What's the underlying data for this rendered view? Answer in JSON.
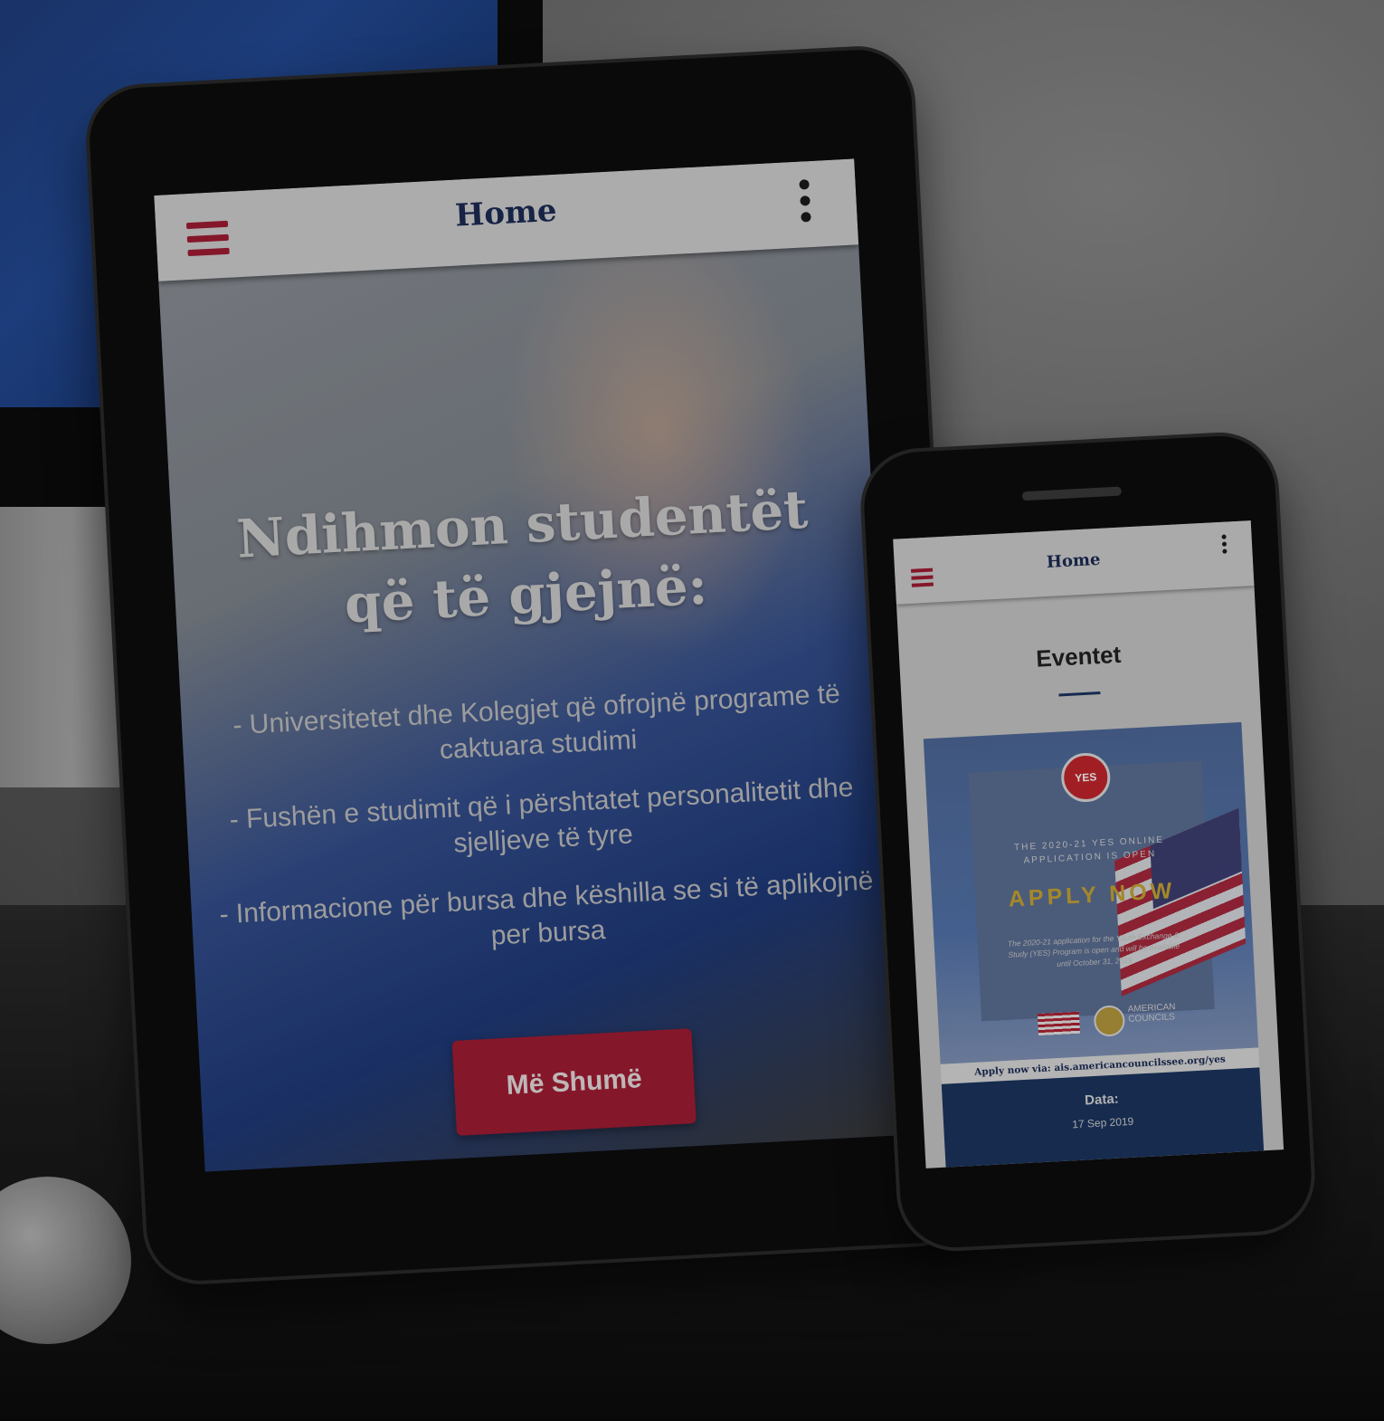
{
  "tablet": {
    "header": {
      "title": "Home",
      "menu_icon": "hamburger-icon",
      "more_icon": "more-vertical-icon"
    },
    "hero": {
      "headline": "Ndihmon studentët që të gjejnë:",
      "bullets": [
        "- Universitetet dhe Kolegjet që ofrojnë programe të caktuara studimi",
        "- Fushën e studimit që i përshtatet personalitetit dhe sjelljeve të tyre",
        "- Informacione për bursa dhe këshilla se si të aplikojnë per bursa"
      ],
      "button_label": "Më Shumë"
    }
  },
  "phone": {
    "header": {
      "title": "Home",
      "menu_icon": "hamburger-icon",
      "more_icon": "more-vertical-icon"
    },
    "section_title": "Eventet",
    "event": {
      "logo_text": "YES",
      "line1": "THE 2020-21 YES ONLINE",
      "line2": "APPLICATION IS OPEN",
      "headline": "APPLY NOW",
      "description": "The 2020-21 application for the Youth Exchange & Study (YES) Program is open and will be available until October 31, 2019",
      "partner": "AMERICAN COUNCILS",
      "apply_via": "Apply now via: ais.americancouncilssee.org/yes",
      "date_label": "Data:",
      "date_value": "17 Sep 2019"
    }
  },
  "colors": {
    "brand_red": "#a31d34",
    "brand_navy": "#1b3560",
    "apply_gold": "#c9a634"
  }
}
